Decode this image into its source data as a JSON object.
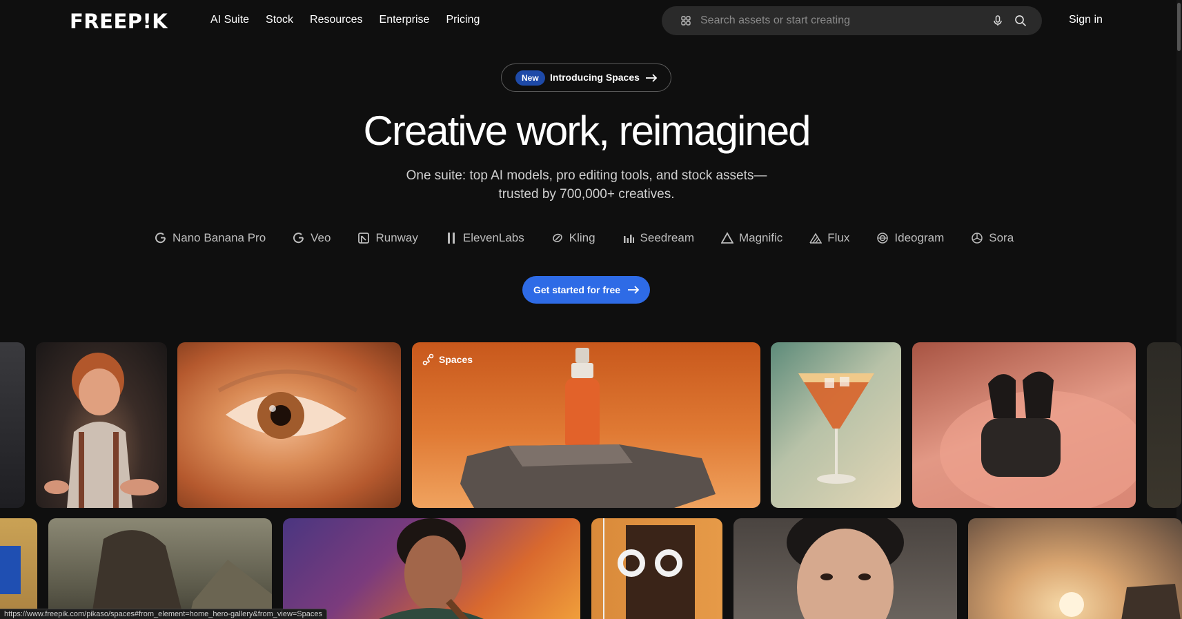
{
  "header": {
    "logo": "FREEP!K",
    "nav": [
      "AI Suite",
      "Stock",
      "Resources",
      "Enterprise",
      "Pricing"
    ],
    "search_placeholder": "Search assets or start creating",
    "signin": "Sign in"
  },
  "hero": {
    "badge": "New",
    "announcement": "Introducing Spaces",
    "title": "Creative work, reimagined",
    "subtitle_line1": "One suite: top AI models, pro editing tools, and stock assets—",
    "subtitle_line2": "trusted by 700,000+ creatives.",
    "models": [
      "Nano Banana Pro",
      "Veo",
      "Runway",
      "ElevenLabs",
      "Kling",
      "Seedream",
      "Magnific",
      "Flux",
      "Ideogram",
      "Sora"
    ],
    "cta": "Get started for free"
  },
  "gallery": {
    "spaces_tag": "Spaces"
  },
  "status_url": "https://www.freepik.com/pikaso/spaces#from_element=home_hero-gallery&from_view=Spaces",
  "colors": {
    "background": "#0f0f0f",
    "accent": "#2e6be6",
    "badge": "#1e4aa8"
  }
}
